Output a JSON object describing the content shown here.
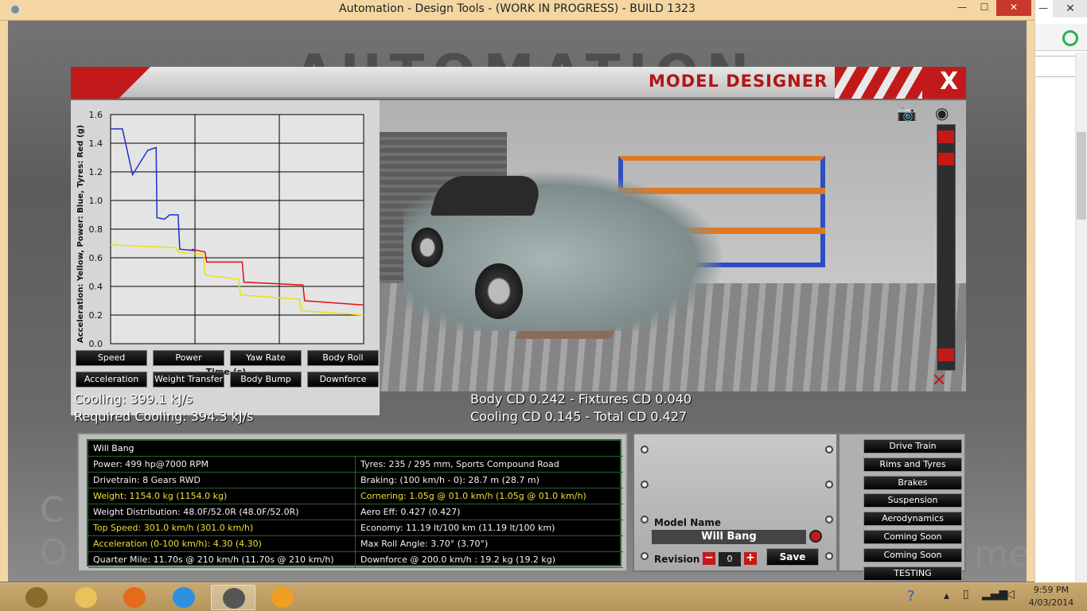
{
  "window": {
    "title": "Automation - Design Tools - (WORK IN PROGRESS) - BUILD 1323",
    "minimize": "—",
    "maximize": "☐",
    "close": "✕"
  },
  "background": {
    "logo": "AUTOMATION",
    "left_text_1": "C",
    "left_text_2": "O",
    "right_text": "me"
  },
  "browser": {
    "min": "—",
    "close": "✕"
  },
  "designer": {
    "title": "MODEL DESIGNER",
    "close": "X"
  },
  "chart_data": {
    "type": "line",
    "title": "",
    "xlabel": "Time (s)",
    "ylabel": "Acceleration: Yellow, Power: Blue, Tyres: Red (g)",
    "xlim": [
      0,
      15
    ],
    "ylim": [
      0,
      1.6
    ],
    "yticks": [
      "0.0",
      "0.2",
      "0.4",
      "0.6",
      "0.8",
      "1.0",
      "1.2",
      "1.4",
      "1.6"
    ],
    "xticks": [
      "0",
      "10"
    ],
    "series": [
      {
        "color": "#1a2fd6",
        "points": [
          [
            0,
            1.5
          ],
          [
            0.7,
            1.5
          ],
          [
            1.3,
            1.18
          ],
          [
            2.2,
            1.35
          ],
          [
            2.7,
            1.37
          ],
          [
            2.75,
            0.88
          ],
          [
            3.2,
            0.87
          ],
          [
            3.5,
            0.9
          ],
          [
            4.0,
            0.9
          ],
          [
            4.1,
            0.66
          ],
          [
            5.0,
            0.65
          ]
        ]
      },
      {
        "color": "#e10f0f",
        "points": [
          [
            4.8,
            0.66
          ],
          [
            5.6,
            0.64
          ],
          [
            5.7,
            0.57
          ],
          [
            7.8,
            0.57
          ],
          [
            7.9,
            0.43
          ],
          [
            11.4,
            0.41
          ],
          [
            11.5,
            0.3
          ],
          [
            15,
            0.27
          ]
        ]
      },
      {
        "color": "#e8e20e",
        "points": [
          [
            0,
            0.69
          ],
          [
            3.9,
            0.67
          ],
          [
            4.0,
            0.64
          ],
          [
            5.5,
            0.62
          ],
          [
            5.6,
            0.48
          ],
          [
            7.6,
            0.45
          ],
          [
            7.7,
            0.34
          ],
          [
            11.2,
            0.31
          ],
          [
            11.3,
            0.23
          ],
          [
            15,
            0.2
          ]
        ]
      }
    ]
  },
  "graph_buttons": [
    "Speed",
    "Power",
    "Yaw Rate",
    "Body Roll",
    "Acceleration",
    "Weight Transfer",
    "Body Bump",
    "Downforce"
  ],
  "stats": {
    "cooling": "Cooling: 399.1 kJ/s",
    "required_cooling": "Required Cooling: 394.3 kJ/s",
    "body_cd": "Body CD 0.242 - Fixtures CD 0.040",
    "cooling_cd": "Cooling CD 0.145 - Total CD 0.427"
  },
  "info": {
    "name": "Will Bang",
    "rows": [
      {
        "left": "Power: 499 hp@7000 RPM",
        "left_color": "white",
        "right": "Tyres: 235 / 295 mm, Sports Compound Road",
        "right_color": "white"
      },
      {
        "left": "Drivetrain: 8 Gears RWD",
        "left_color": "white",
        "right": "Braking: (100 km/h - 0): 28.7 m (28.7 m)",
        "right_color": "white"
      },
      {
        "left": "Weight: 1154.0 kg (1154.0 kg)",
        "left_color": "yellow",
        "right": "Cornering: 1.05g @ 01.0 km/h (1.05g @ 01.0 km/h)",
        "right_color": "yellow"
      },
      {
        "left": "Weight Distribution: 48.0F/52.0R (48.0F/52.0R)",
        "left_color": "white",
        "right": "Aero Eff: 0.427 (0.427)",
        "right_color": "white"
      },
      {
        "left": "Top Speed: 301.0 km/h (301.0 km/h)",
        "left_color": "yellow",
        "right": "Economy: 11.19 lt/100 km (11.19 lt/100 km)",
        "right_color": "white"
      },
      {
        "left": "Acceleration (0-100 km/h): 4.30 (4.30)",
        "left_color": "yellow",
        "right": "Max Roll Angle: 3.70° (3.70°)",
        "right_color": "white"
      },
      {
        "left": "Quarter Mile: 11.70s @ 210 km/h (11.70s @ 210 km/h)",
        "left_color": "white",
        "right": "Downforce @ 200.0 km/h : 19.2 kg (19.2 kg)",
        "right_color": "white"
      }
    ]
  },
  "model": {
    "name_label": "Model Name",
    "name_value": "Will Bang",
    "revision_label": "Revision",
    "revision_value": "0",
    "minus": "−",
    "plus": "+",
    "save": "Save"
  },
  "menu": [
    "Drive Train",
    "Rims and Tyres",
    "Brakes",
    "Suspension",
    "Aerodynamics",
    "Coming Soon",
    "Coming Soon",
    "TESTING"
  ],
  "taskbar": {
    "apps": [
      {
        "name": "warcraft-icon",
        "color": "#8a6a2a"
      },
      {
        "name": "file-explorer-icon",
        "color": "#e8c25a"
      },
      {
        "name": "firefox-icon",
        "color": "#e56a1c"
      },
      {
        "name": "internet-explorer-icon",
        "color": "#2f8fe0"
      },
      {
        "name": "automation-icon",
        "color": "#555555"
      },
      {
        "name": "game-app-icon",
        "color": "#f0a020"
      }
    ],
    "time": "9:59 PM",
    "date": "4/03/2014"
  }
}
